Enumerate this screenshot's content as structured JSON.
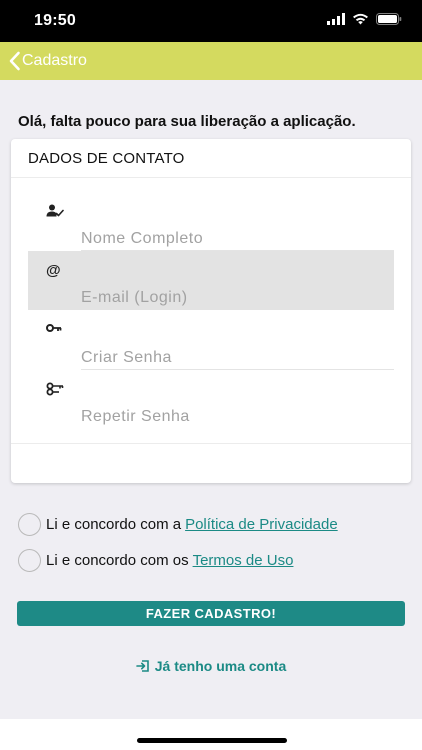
{
  "status_bar": {
    "time": "19:50"
  },
  "nav": {
    "back_label": "Cadastro"
  },
  "greeting": "Olá, falta pouco para sua liberação a aplicação.",
  "card": {
    "title": "DADOS DE CONTATO",
    "fields": [
      {
        "placeholder": "Nome Completo",
        "value": "",
        "icon": "person-check-icon"
      },
      {
        "placeholder": "E-mail (Login)",
        "value": "",
        "icon": "at-icon"
      },
      {
        "placeholder": "Criar Senha",
        "value": "",
        "icon": "key-icon"
      },
      {
        "placeholder": "Repetir Senha",
        "value": "",
        "icon": "key-double-icon"
      }
    ]
  },
  "agreements": {
    "privacy_prefix": "Li e concordo com a",
    "privacy_link": "Política de Privacidade",
    "terms_prefix": "Li e concordo com os",
    "terms_link": "Termos de Uso"
  },
  "submit_label": "FAZER CADASTRO!",
  "login_link": "Já tenho uma conta",
  "colors": {
    "nav_bar": "#d4da5f",
    "accent": "#1e8a86",
    "background": "#efeef3"
  }
}
